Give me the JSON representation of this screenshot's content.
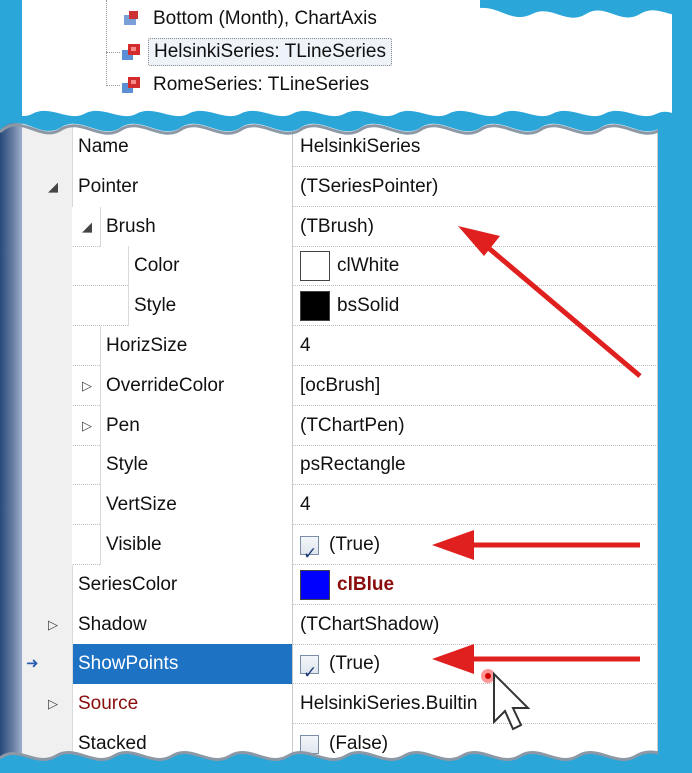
{
  "tree": {
    "items": [
      {
        "label": "Bottom (Month), ChartAxis",
        "selected": false
      },
      {
        "label": "HelsinkiSeries: TLineSeries",
        "selected": true
      },
      {
        "label": "RomeSeries: TLineSeries",
        "selected": false
      }
    ]
  },
  "properties": [
    {
      "name": "Name",
      "value": "HelsinkiSeries",
      "level": 0,
      "expander": "",
      "kind": "text"
    },
    {
      "name": "Pointer",
      "value": "(TSeriesPointer)",
      "level": 0,
      "expander": "expanded",
      "kind": "text"
    },
    {
      "name": "Brush",
      "value": "(TBrush)",
      "level": 1,
      "expander": "expanded",
      "kind": "text"
    },
    {
      "name": "Color",
      "value": "clWhite",
      "level": 2,
      "expander": "",
      "kind": "color",
      "swatch": "#ffffff"
    },
    {
      "name": "Style",
      "value": "bsSolid",
      "level": 2,
      "expander": "",
      "kind": "color",
      "swatch": "#000000"
    },
    {
      "name": "HorizSize",
      "value": "4",
      "level": 1,
      "expander": "",
      "kind": "text"
    },
    {
      "name": "OverrideColor",
      "value": "[ocBrush]",
      "level": 1,
      "expander": "collapsed",
      "kind": "text"
    },
    {
      "name": "Pen",
      "value": "(TChartPen)",
      "level": 1,
      "expander": "collapsed",
      "kind": "text"
    },
    {
      "name": "Style",
      "value": "psRectangle",
      "level": 1,
      "expander": "",
      "kind": "text"
    },
    {
      "name": "VertSize",
      "value": "4",
      "level": 1,
      "expander": "",
      "kind": "text"
    },
    {
      "name": "Visible",
      "value": "(True)",
      "level": 1,
      "expander": "",
      "kind": "check",
      "checked": true
    },
    {
      "name": "SeriesColor",
      "value": "clBlue",
      "level": 0,
      "expander": "",
      "kind": "color",
      "swatch": "#0000ff",
      "emphasis": true
    },
    {
      "name": "Shadow",
      "value": "(TChartShadow)",
      "level": 0,
      "expander": "collapsed",
      "kind": "text"
    },
    {
      "name": "ShowPoints",
      "value": "(True)",
      "level": 0,
      "expander": "",
      "kind": "check",
      "checked": true,
      "selected": true
    },
    {
      "name": "Source",
      "value": "HelsinkiSeries.Builtin",
      "level": 0,
      "expander": "collapsed",
      "kind": "text",
      "dark": true
    },
    {
      "name": "Stacked",
      "value": "(False)",
      "level": 0,
      "expander": "",
      "kind": "check",
      "checked": false
    }
  ],
  "colors": {
    "selection": "#1e72c4",
    "arrow": "#e0201f",
    "background": "#2aa6d8"
  }
}
